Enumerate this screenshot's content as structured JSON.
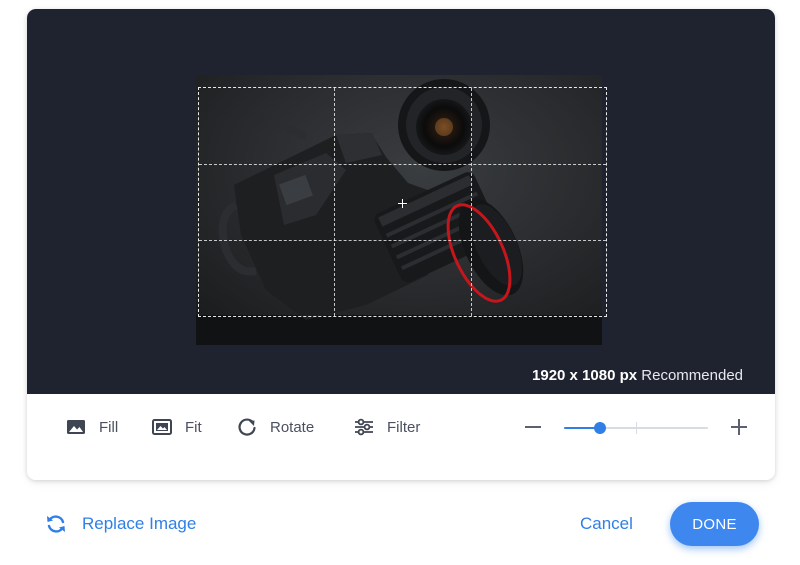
{
  "preview": {
    "image_alt": "camera-photo",
    "recommendation": {
      "size": "1920 x 1080 px",
      "label": "Recommended"
    }
  },
  "toolbar": {
    "tools": [
      {
        "label": "Fill",
        "icon": "image-fill-icon"
      },
      {
        "label": "Fit",
        "icon": "image-fit-icon"
      },
      {
        "label": "Rotate",
        "icon": "rotate-icon"
      },
      {
        "label": "Filter",
        "icon": "filter-sliders-icon"
      }
    ],
    "zoom": {
      "value": 0.25,
      "minus_icon": "minus-icon",
      "plus_icon": "plus-icon"
    }
  },
  "footer": {
    "replace_label": "Replace Image",
    "replace_icon": "refresh-icon",
    "cancel_label": "Cancel",
    "done_label": "DONE"
  },
  "colors": {
    "accent": "#2f7fe6",
    "preview_bg": "#1f2330",
    "lens_ring": "#c4161c"
  }
}
